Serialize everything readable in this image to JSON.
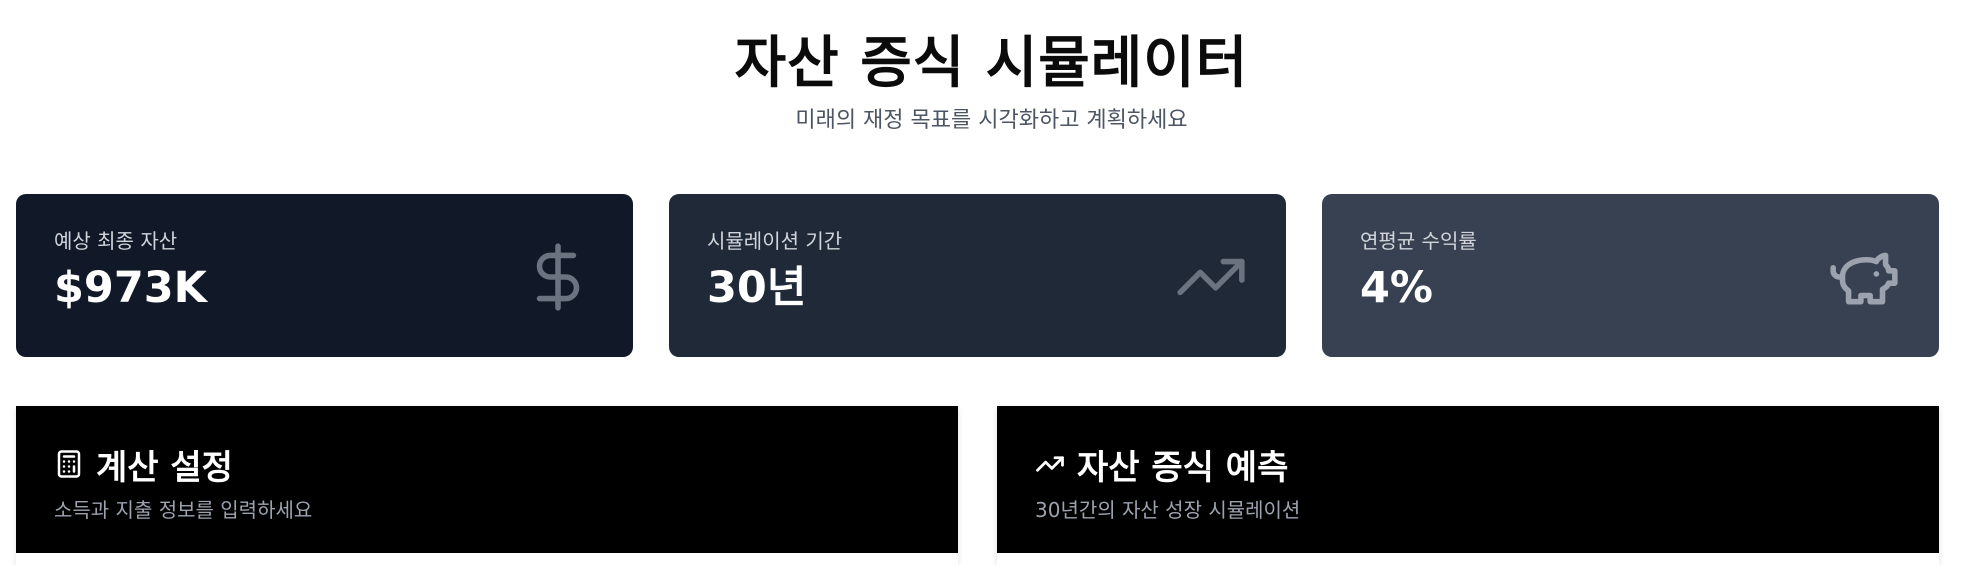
{
  "header": {
    "title": "자산 증식 시뮬레이터",
    "subtitle": "미래의 재정 목표를 시각화하고 계획하세요"
  },
  "stats": [
    {
      "label": "예상 최종 자산",
      "value": "$973K",
      "icon": "dollar-icon"
    },
    {
      "label": "시뮬레이션 기간",
      "value": "30년",
      "icon": "trending-up-icon"
    },
    {
      "label": "연평균 수익률",
      "value": "4%",
      "icon": "piggy-bank-icon"
    }
  ],
  "panels": {
    "settings": {
      "title": "계산 설정",
      "subtitle": "소득과 지출 정보를 입력하세요",
      "icon": "calculator-icon"
    },
    "forecast": {
      "title": "자산 증식 예측",
      "subtitle": "30년간의 자산 성장 시뮬레이션",
      "icon": "trending-up-icon"
    }
  },
  "colors": {
    "card1": "#111827",
    "card2": "#1f2937",
    "card3": "#374151",
    "panel_header": "#000000",
    "icon_muted": "#6b7280"
  }
}
